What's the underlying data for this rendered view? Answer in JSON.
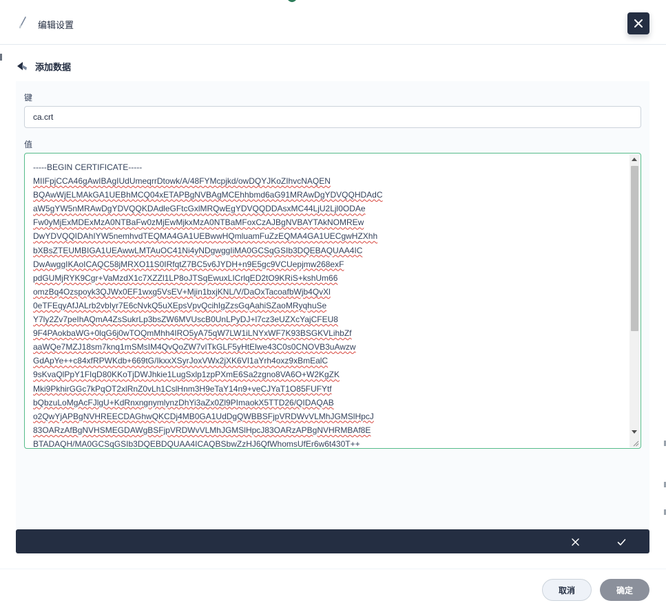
{
  "header": {
    "title": "编辑设置"
  },
  "back": {
    "label": "添加数据"
  },
  "form": {
    "key_label": "键",
    "key_value": "ca.crt",
    "value_label": "值",
    "value_lines": [
      "-----BEGIN CERTIFICATE-----",
      "MIIFpjCCA46gAwIBAgIUdUmeqrrDtowk/A/48FYMcpjkd/owDQYJKoZIhvcNAQEN",
      "BQAwWjELMAkGA1UEBhMCQ04xETAPBgNVBAgMCEhhbmd6aG91MRAwDgYDVQQHDAdC",
      "aW5gYW5nMRAwDgYDVQQKDAdleGFtcGxlMRQwEgYDVQQDDAsxMC44LjU2Ljl0ODAe",
      "Fw0yMjExMDExMzA0NTBaFw0zMjEwMjkxMzA0NTBaMFoxCzAJBgNVBAYTAkNOMREw",
      "DwYDVQQIDAhIYW5nemhvdTEQMA4GA1UEBwwHQmluamFuZzEQMA4GA1UECgwHZXhh",
      "bXBsZTEUMBIGA1UEAwwLMTAuOC41Ni4yNDgwggIiMA0GCSqGSIb3DQEBAQUAA4IC",
      "DwAwggIKAoICAQC58jMRXO11S0IRfqtZ7BC5v6JYDH+n9E5gc9VCUepjmw268exF",
      "pdGUMjRYK9Cgr+VaMzdX1c7XZZl1LP8oJTSqEwuxLICrlqED2tO9KRiS+kshUm66",
      "omzBq4Ozspoyk3QJWx0EF1wxg5VsEV+Mjin1bxjKNL/V/DaOxTacoafbWjb4QvXl",
      "0eTFEqyAfJALrb2vbIyr7E6cNvkQ5uXEpsVpvQcihIgZzsGqAahiSZaoMRyqhuSe",
      "Y7ly2Zv7peIhAQmA4ZsSukrLp3bsZW6MVUscB0UnLPyDJ+l7cz3eUZXcYajCFEU8",
      "9F4PAokbaWG+0lqG6j0wTOQmMhh4IRO5yA75qW7LW1iLNYxWF7K93BSGKVLihbZf",
      "aaWQe7MZJ18sm7knq1mSMsIM4QvQoZW7vITkGLF5yHtElwe43C0s0CNOVB3uAwzw",
      "GdApYe++c84xfRPWKdb+669tG/IkxxXSyrJoxVWx2jXK6VI1aYrh4oxz9xBmEalC",
      "9sKvaQlPpY1FIqD80KKoTjDWJhkie1LugSxlp1zpPXmE6Sa2zgno8VA6O+W2KgZK",
      "Mki9PkhirGGc7kPqOT2xlRnZ0vLh1CslHnm3H9eTaY14n9+veCJYaT1O85FUFYtf",
      "bQbzuLoMgAcFJlgU+KdRnxngnymlynzDhYi3aZx0Zl9PImaokX5TTD26/QIDAQAB",
      "o2QwYjAPBgNVHREECDAGhwQKCDj4MB0GA1UdDgQWBBSFjpVRDWvVLMhJGMSlHpcJ",
      "83OARzAfBgNVHSMEGDAWgBSFjpVRDWvVLMhJGMSlHpcJ83OARzAPBgNVHRMBAf8E",
      "BTADAQH/MA0GCSqGSIb3DQEBDQUAA4ICAQBSbwZzHJ6QfWhomsUfEr6w6t430T++"
    ]
  },
  "footer": {
    "cancel_label": "取消",
    "ok_label": "确定"
  },
  "colors": {
    "dark": "#242e42",
    "accent_green": "#55bc8a",
    "panel_bg": "#f9fbfd",
    "ok_disabled": "#8b909b"
  },
  "icons": {
    "header": "pen-icon",
    "back": "back-arrow-icon",
    "close": "close-icon",
    "cancel_row": "close-icon",
    "confirm_row": "check-icon"
  }
}
